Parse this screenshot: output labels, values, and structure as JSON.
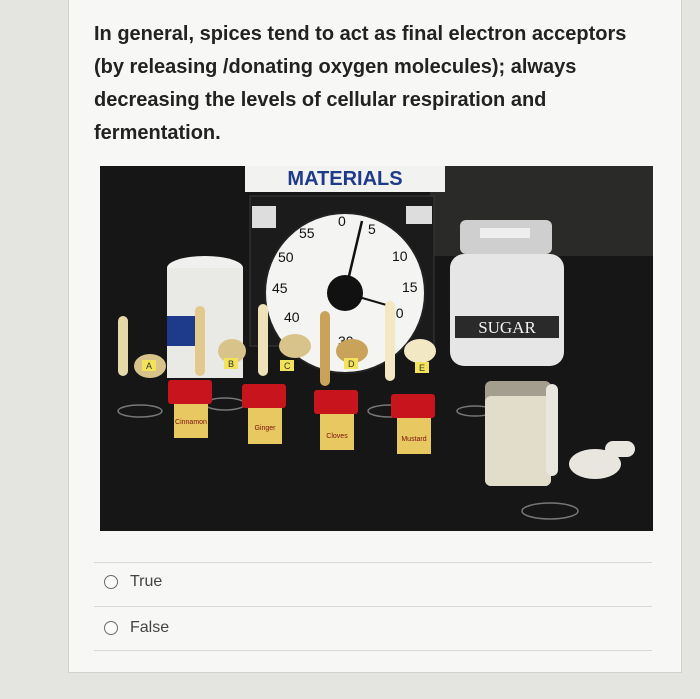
{
  "question": {
    "text": "In general, spices tend to act as final electron acceptors (by releasing /donating oxygen molecules); always decreasing the levels of cellular respiration and fermentation."
  },
  "photo": {
    "poster_text": "MATERIALS",
    "jar_label": "SUGAR",
    "timer_numbers": [
      "0",
      "5",
      "10",
      "15",
      "20",
      "30",
      "40",
      "45",
      "50",
      "55"
    ],
    "tube_labels": [
      "A",
      "B",
      "C",
      "D",
      "E"
    ],
    "spice_labels": [
      "Cinnamon",
      "Ginger",
      "Cloves",
      "Mustard"
    ],
    "background_color": "#141414",
    "poster_color": "#1e3a8a",
    "cap_color": "#c8141c"
  },
  "options": [
    {
      "label": "True"
    },
    {
      "label": "False"
    }
  ]
}
